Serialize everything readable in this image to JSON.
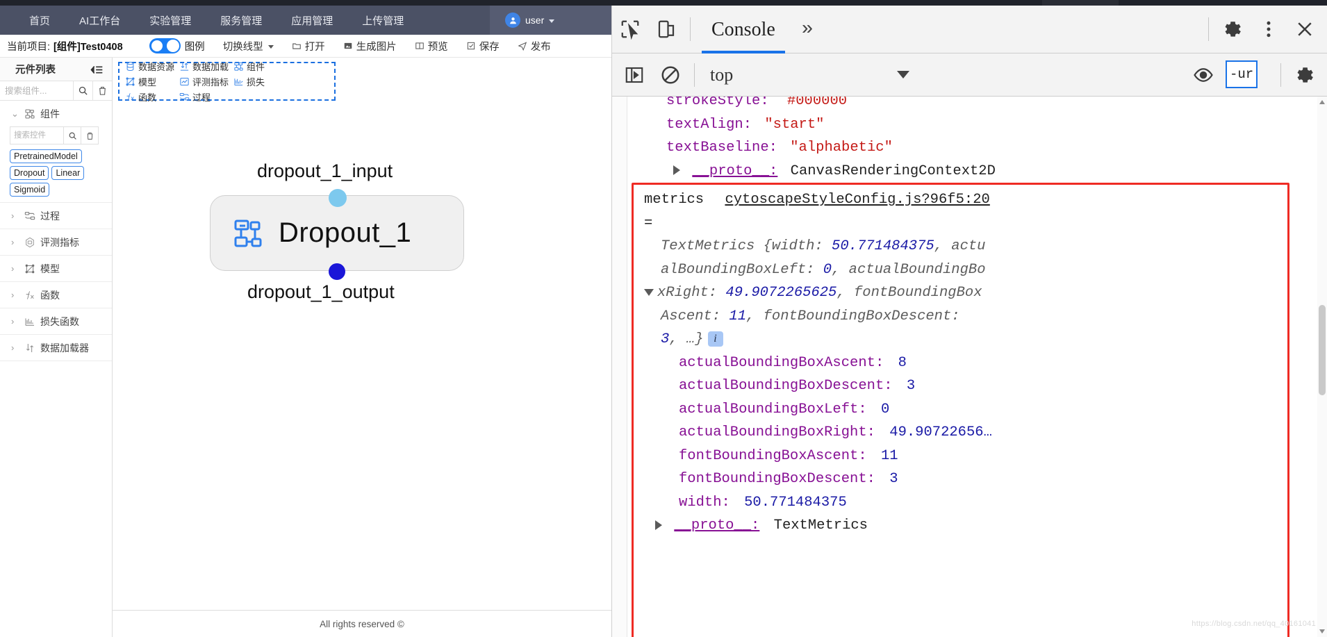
{
  "app": {
    "nav": {
      "items": [
        {
          "label": "首页"
        },
        {
          "label": "AI工作台"
        },
        {
          "label": "实验管理"
        },
        {
          "label": "服务管理"
        },
        {
          "label": "应用管理"
        },
        {
          "label": "上传管理"
        }
      ],
      "user": {
        "name": "user",
        "icon": "user-icon"
      }
    },
    "projectbar": {
      "label": "当前项目:",
      "project_name": "[组件]Test0408",
      "legend_toggle_label": "图例",
      "legend_toggle_on": true,
      "line_type": "切换线型",
      "open": "打开",
      "generate_image": "生成图片",
      "preview": "预览",
      "save": "保存",
      "publish": "发布"
    },
    "sidebar": {
      "title": "元件列表",
      "collapse_icon": "collapse-panel-icon",
      "search_placeholder": "搜索组件...",
      "search_value": "",
      "search_icon": "search-icon",
      "delete_icon": "trash-icon",
      "nodes": [
        {
          "label": "组件",
          "icon": "component-icon",
          "expanded": true,
          "inner_search_placeholder": "搜索控件",
          "inner_search_value": "",
          "chips": [
            "PretrainedModel",
            "Dropout",
            "Linear",
            "Sigmoid"
          ]
        },
        {
          "label": "过程",
          "icon": "process-icon",
          "expanded": false
        },
        {
          "label": "评测指标",
          "icon": "metric-icon",
          "expanded": false
        },
        {
          "label": "模型",
          "icon": "model-icon",
          "expanded": false
        },
        {
          "label": "函数",
          "icon": "function-icon",
          "expanded": false
        },
        {
          "label": "损失函数",
          "icon": "loss-icon",
          "expanded": false
        },
        {
          "label": "数据加载器",
          "icon": "dataloader-icon",
          "expanded": false
        }
      ]
    },
    "palette": {
      "items": [
        {
          "label": "数据资源",
          "icon": "database-icon"
        },
        {
          "label": "数据加载",
          "icon": "dataload-icon"
        },
        {
          "label": "组件",
          "icon": "component-icon"
        },
        {
          "label": "模型",
          "icon": "model-icon"
        },
        {
          "label": "评测指标",
          "icon": "metric-icon"
        },
        {
          "label": "损失",
          "icon": "loss-icon"
        },
        {
          "label": "函数",
          "icon": "function-icon"
        },
        {
          "label": "过程",
          "icon": "process-icon"
        }
      ]
    },
    "canvas": {
      "input_label": "dropout_1_input",
      "output_label": "dropout_1_output",
      "node_title": "Dropout_1",
      "node_icon": "component-icon",
      "input_port_color": "#7dc9ee",
      "output_port_color": "#1a16d8"
    },
    "footer": "All rights reserved ©"
  },
  "devtools": {
    "toolbar": {
      "inspect_icon": "inspect-cursor-icon",
      "device_icon": "device-toolbar-icon",
      "tab": "Console",
      "more_tabs_icon": "chevron-double-right-icon",
      "settings_icon": "gear-icon",
      "kebab_icon": "more-vertical-icon",
      "close_icon": "close-icon"
    },
    "filterbar": {
      "sidebar_icon": "console-sidebar-icon",
      "clear_icon": "clear-console-icon",
      "context": "top",
      "context_caret_icon": "chevron-down-icon",
      "eye_icon": "live-expression-icon",
      "filter_value": "-ur",
      "settings_icon": "gear-icon"
    },
    "console": {
      "preceding": [
        {
          "key": "strokeStyle:",
          "value": "#000000",
          "value_kind": "red"
        },
        {
          "key": "textAlign:",
          "value": "\"start\"",
          "value_kind": "red"
        },
        {
          "key": "textBaseline:",
          "value": "\"alphabetic\"",
          "value_kind": "red"
        },
        {
          "key": "__proto__:",
          "value": "CanvasRenderingContext2D",
          "value_kind": "black"
        }
      ],
      "message": {
        "label": "metrics",
        "source": "cytoscapeStyleConfig.js?96f5:20",
        "equals": "=",
        "summary_lines": [
          "TextMetrics {width: 50.771484375, actu",
          "alBoundingBoxLeft: 0, actualBoundingBo",
          "xRight: 49.9072265625, fontBoundingBox",
          "Ascent: 11, fontBoundingBoxDescent:",
          "3, …}"
        ],
        "info_badge": "i",
        "properties": [
          {
            "name": "actualBoundingBoxAscent:",
            "value": "8"
          },
          {
            "name": "actualBoundingBoxDescent:",
            "value": "3"
          },
          {
            "name": "actualBoundingBoxLeft:",
            "value": "0"
          },
          {
            "name": "actualBoundingBoxRight:",
            "value": "49.90722656…"
          },
          {
            "name": "fontBoundingBoxAscent:",
            "value": "11"
          },
          {
            "name": "fontBoundingBoxDescent:",
            "value": "3"
          },
          {
            "name": "width:",
            "value": "50.771484375"
          },
          {
            "name": "__proto__:",
            "value": "TextMetrics",
            "proto": true
          }
        ]
      }
    },
    "watermark": "https://blog.csdn.net/qq_40161041"
  }
}
